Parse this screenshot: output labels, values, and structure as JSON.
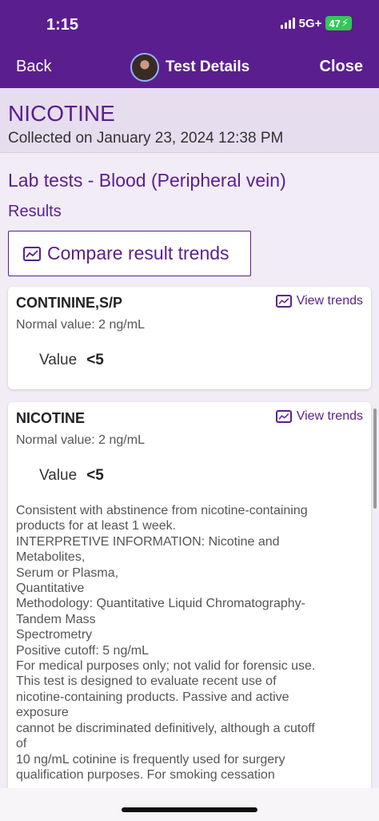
{
  "status": {
    "time": "1:15",
    "network": "5G+",
    "battery": "47",
    "battery_icon": "charging-bolt-icon"
  },
  "nav": {
    "back_label": "Back",
    "title": "Test Details",
    "close_label": "Close"
  },
  "header": {
    "test_name": "NICOTINE",
    "collected": "Collected on January 23, 2024 12:38 PM"
  },
  "lab": {
    "title": "Lab tests - Blood (Peripheral vein)",
    "results_heading": "Results",
    "compare_label": "Compare result trends"
  },
  "results": [
    {
      "name": "CONTININE,S/P",
      "view_trends_label": "View trends",
      "normal_value": "Normal value: 2 ng/mL",
      "value_label": "Value",
      "value": "<5"
    },
    {
      "name": "NICOTINE",
      "view_trends_label": "View trends",
      "normal_value": "Normal value: 2 ng/mL",
      "value_label": "Value",
      "value": "<5",
      "interpretation": "Consistent with abstinence from nicotine-containing\nproducts for at least 1 week.\nINTERPRETIVE INFORMATION: Nicotine and\nMetabolites,\nSerum or Plasma,\nQuantitative\nMethodology: Quantitative Liquid Chromatography-\nTandem Mass\nSpectrometry\nPositive cutoff: 5 ng/mL\nFor medical purposes only; not valid for forensic use.\nThis test is designed to evaluate recent use of\nnicotine-containing products. Passive and active\nexposure\ncannot be discriminated definitively, although a cutoff\nof\n10 ng/mL cotinine is frequently used for surgery\nqualification purposes. For smoking cessation"
    }
  ],
  "colors": {
    "brand": "#5b1e8f",
    "header_bg": "#e6ddef",
    "page_bg": "#f1ecf6",
    "battery": "#34c759"
  }
}
